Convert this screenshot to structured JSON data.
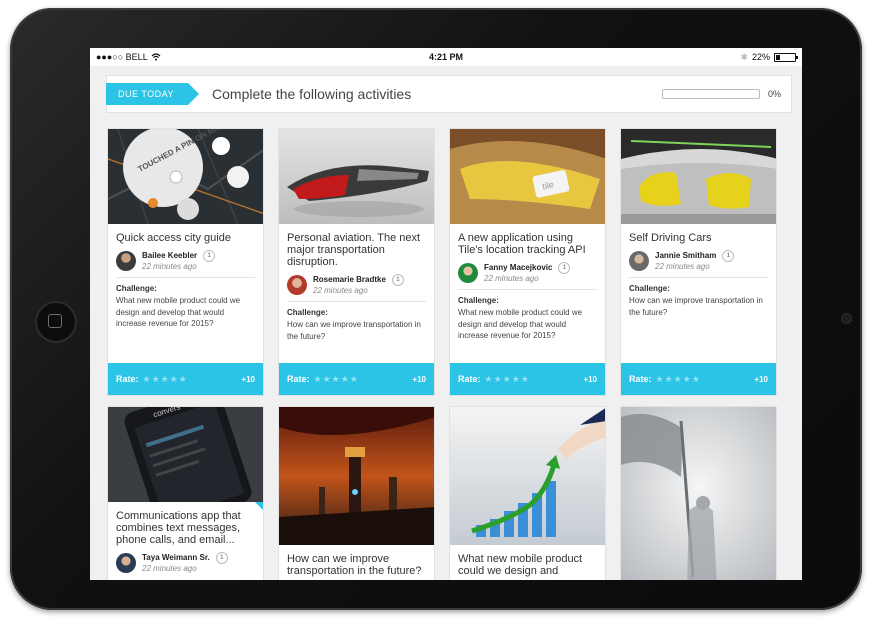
{
  "status_bar": {
    "carrier": "●●●○○ BELL",
    "time": "4:21 PM",
    "battery": "22%"
  },
  "due": {
    "tag": "DUE TODAY",
    "title": "Complete the following activities",
    "progress_percent": 0,
    "progress_label": "0%"
  },
  "cards": [
    {
      "title": "Quick access city guide",
      "author": "Bailee Keebler",
      "time": "22 minutes ago",
      "count": "1",
      "challenge_label": "Challenge:",
      "challenge": "What new mobile product could we design and develop that would increase revenue for 2015?",
      "rate_label": "Rate:",
      "stars": "★★★★★",
      "points": "+10",
      "image_text": "TOUCHED A PIN ON MAP"
    },
    {
      "title": "Personal aviation. The next major transportation disruption.",
      "author": "Rosemarie Bradtke",
      "time": "22 minutes ago",
      "count": "1",
      "challenge_label": "Challenge:",
      "challenge": "How can we improve transportation in the future?",
      "rate_label": "Rate:",
      "stars": "★★★★★",
      "points": "+10"
    },
    {
      "title": "A new application using Tile's location tracking API",
      "author": "Fanny Macejkovic",
      "time": "22 minutes ago",
      "count": "1",
      "challenge_label": "Challenge:",
      "challenge": "What new mobile product could we design and develop that would increase revenue for 2015?",
      "rate_label": "Rate:",
      "stars": "★★★★★",
      "points": "+10",
      "image_text": "tile"
    },
    {
      "title": "Self Driving Cars",
      "author": "Jannie Smitham",
      "time": "22 minutes ago",
      "count": "1",
      "challenge_label": "Challenge:",
      "challenge": "How can we improve transportation in the future?",
      "rate_label": "Rate:",
      "stars": "★★★★★",
      "points": "+10"
    },
    {
      "title": "Communications app that combines text messages, phone calls, and email...",
      "author": "Taya Weimann Sr.",
      "time": "22 minutes ago",
      "count": "1",
      "image_text": "convers"
    },
    {
      "title": "How can we improve transportation in the future?"
    },
    {
      "title": "What new mobile product could we design and"
    },
    {
      "title": ""
    }
  ],
  "colors": {
    "accent": "#2bc4e6",
    "card_bg": "#ffffff",
    "screen_bg": "#f0f0f0"
  }
}
